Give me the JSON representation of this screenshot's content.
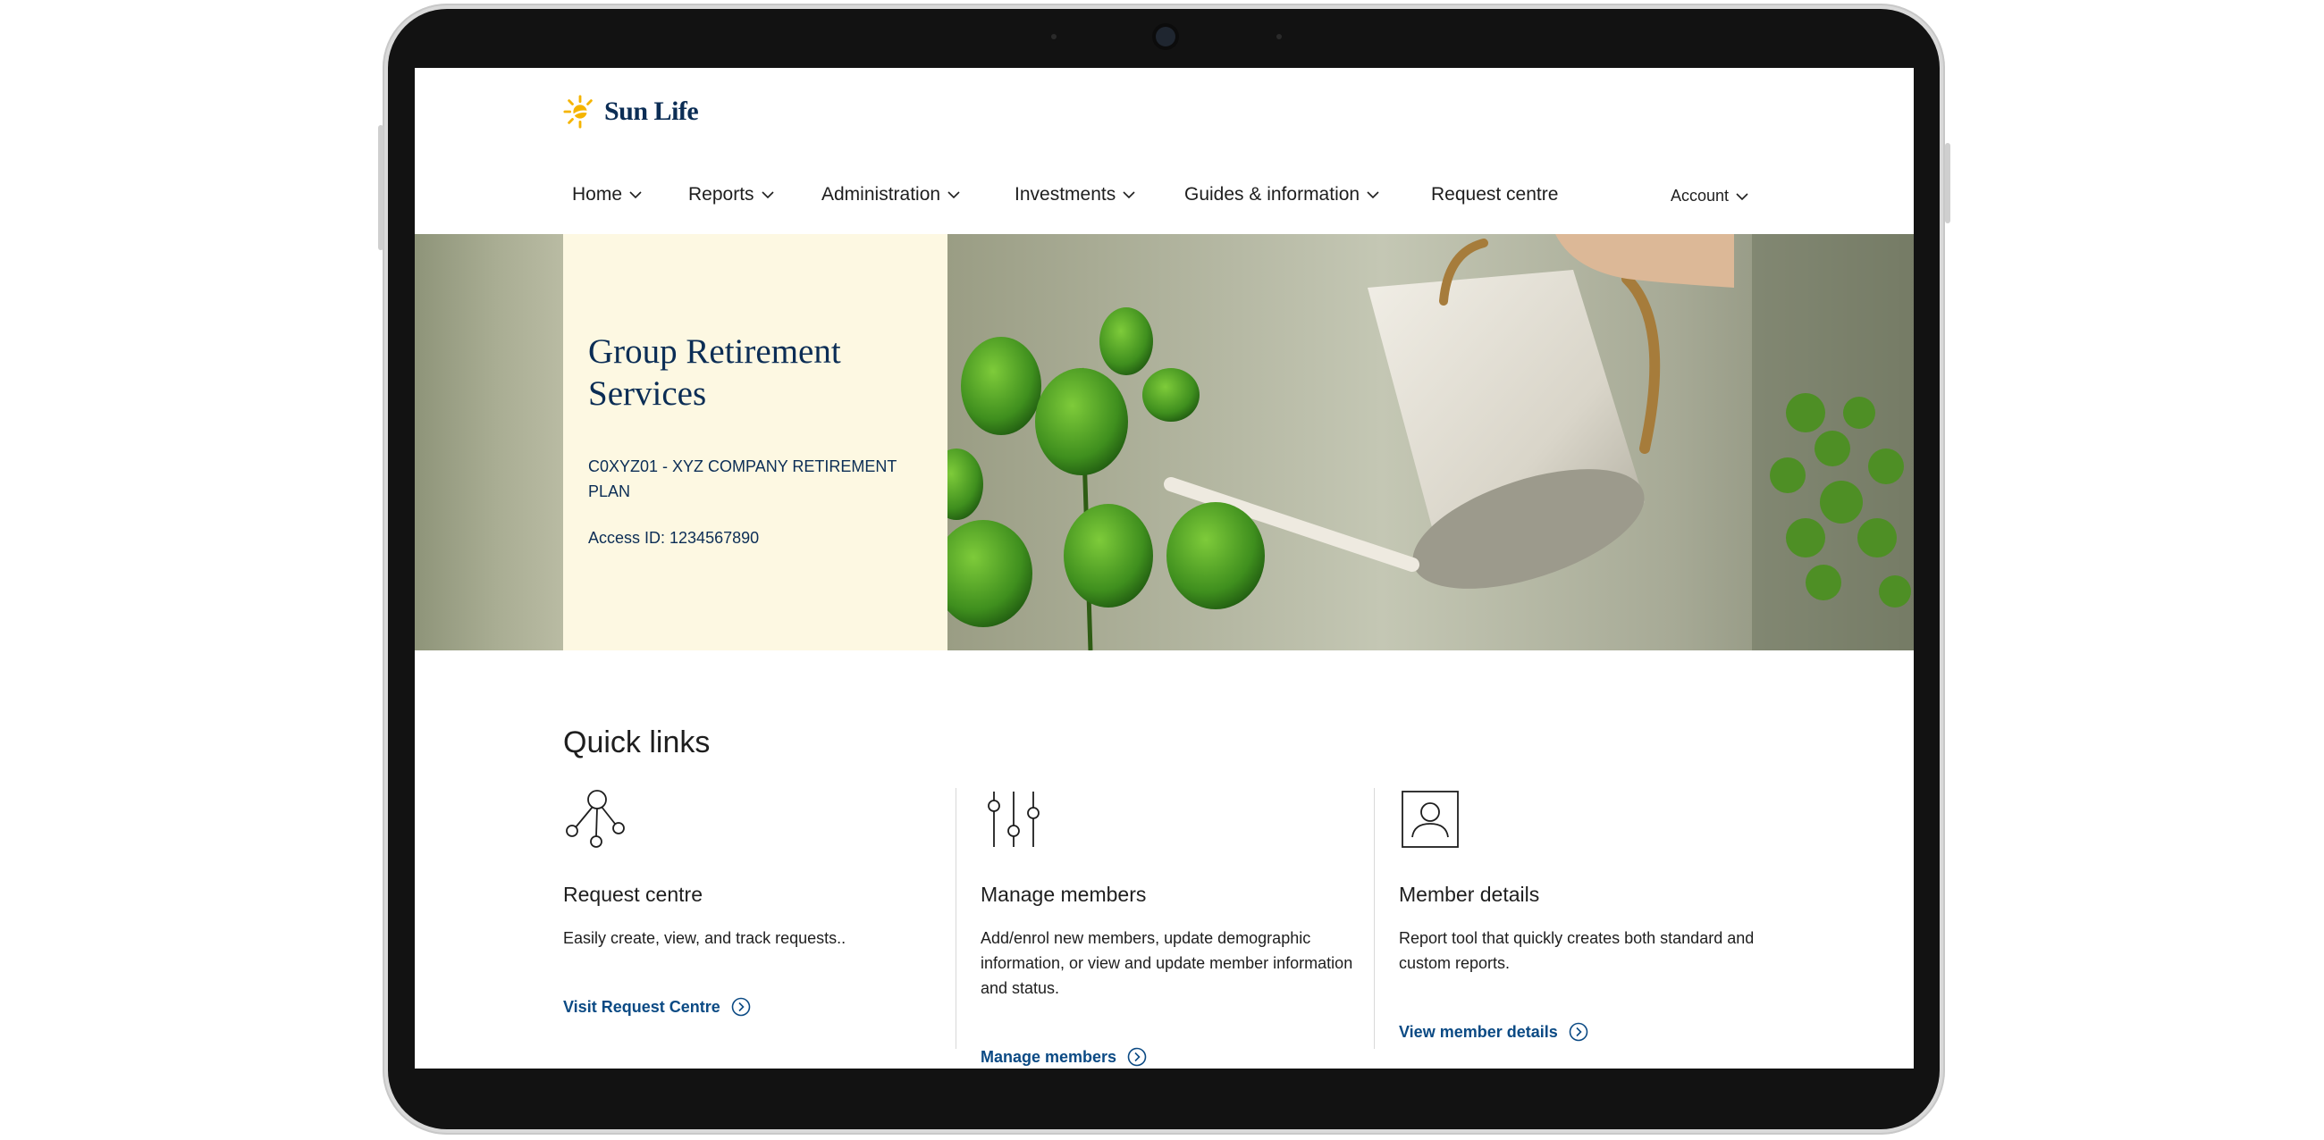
{
  "brand": {
    "name": "Sun Life"
  },
  "nav": {
    "items": [
      {
        "label": "Home",
        "has_menu": true
      },
      {
        "label": "Reports",
        "has_menu": true
      },
      {
        "label": "Administration",
        "has_menu": true
      },
      {
        "label": "Investments",
        "has_menu": true
      },
      {
        "label": "Guides & information",
        "has_menu": true
      },
      {
        "label": "Request centre",
        "has_menu": false
      }
    ],
    "account": {
      "label": "Account",
      "has_menu": true
    }
  },
  "hero": {
    "title": "Group Retirement Services",
    "plan": "C0XYZ01 - XYZ COMPANY RETIREMENT PLAN",
    "access_id": "Access ID: 1234567890"
  },
  "quick_links": {
    "title": "Quick links",
    "cards": [
      {
        "icon": "network-icon",
        "title": "Request centre",
        "description": "Easily create, view, and track requests..",
        "link": "Visit Request Centre"
      },
      {
        "icon": "sliders-icon",
        "title": "Manage members",
        "description": "Add/enrol new members, update demographic information, or view and update member information and status.",
        "link": "Manage members"
      },
      {
        "icon": "user-profile-icon",
        "title": "Member details",
        "description": "Report tool that quickly creates both standard and custom reports.",
        "link": "View member details"
      }
    ]
  },
  "colors": {
    "navy": "#0b2d55",
    "link": "#0b4a84",
    "hero_panel": "#fdf8e2",
    "brand_yellow": "#f5b400"
  }
}
